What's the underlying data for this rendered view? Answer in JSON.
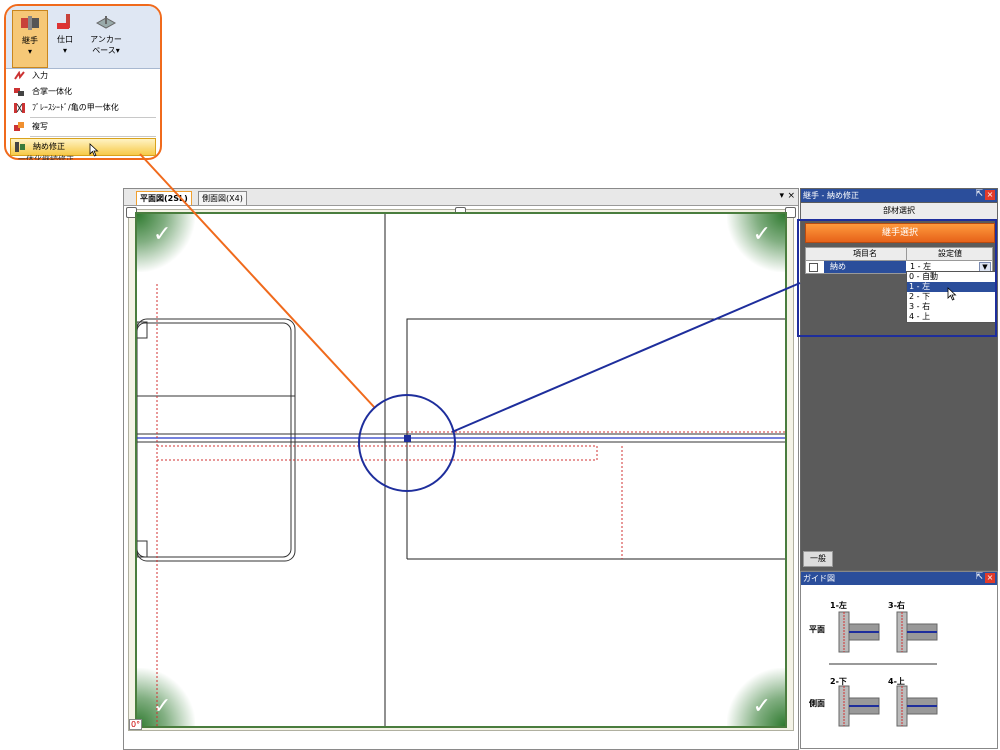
{
  "ribbon": {
    "buttons": [
      {
        "label": "継手",
        "arrow": "▾",
        "active": true
      },
      {
        "label": "仕口",
        "arrow": "▾",
        "active": false
      },
      {
        "label": "アンカー",
        "label2": "ベース▾",
        "active": false
      }
    ],
    "menu_items": [
      {
        "label": "入力",
        "icon": "input-icon"
      },
      {
        "label": "合掌一体化",
        "icon": "gassho-merge-icon"
      },
      {
        "label": "ﾌﾞﾚｰｽｼｰﾄﾞ/亀の甲一体化",
        "icon": "brace-merge-icon"
      },
      {
        "label": "複写",
        "icon": "copy-icon"
      },
      {
        "label": "納め修正",
        "icon": "fit-adjust-icon",
        "highlighted": true
      }
    ],
    "cutoff_item": "一体化継続修正"
  },
  "cad": {
    "tabs": [
      "平面図(2SL)",
      "側面図(X4)"
    ],
    "tab_controls": [
      "▾",
      "×"
    ],
    "angle_indicator": "0°",
    "colors": {
      "accent_orange": "#f06a1c",
      "callout_blue": "#1e2e9c",
      "frame_green": "#4a7d3e"
    }
  },
  "panel": {
    "title": "継手 - 納め修正",
    "section_header": "部材選択",
    "action_button": "継手選択",
    "grid": {
      "headers": [
        "項目名",
        "設定値"
      ],
      "row": {
        "name": "納め",
        "value": "1 - 左"
      }
    },
    "dropdown_options": [
      "0 - 自動",
      "1 - 左",
      "2 - 下",
      "3 - 右",
      "4 - 上"
    ],
    "selected_option": "1 - 左",
    "bottom_tab": "一般"
  },
  "guide": {
    "title": "ガイド図",
    "row_labels": [
      "平面",
      "側面"
    ],
    "items": [
      "1-左",
      "3-右",
      "2-下",
      "4-上"
    ]
  }
}
